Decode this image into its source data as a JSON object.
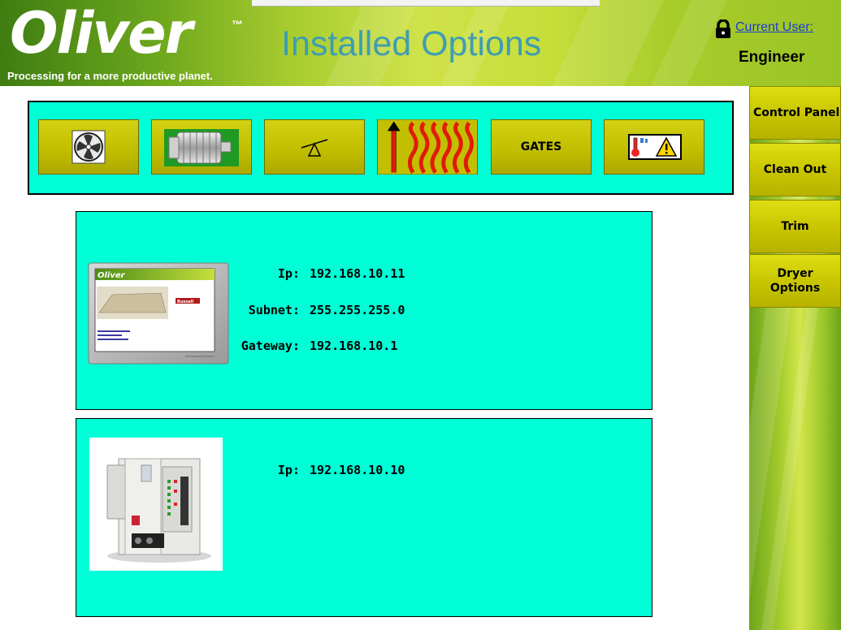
{
  "header": {
    "logo_text": "Oliver",
    "logo_tm": "™",
    "tagline": "Processing for a more productive planet.",
    "page_title": "Installed Options",
    "user_link": "Current User:",
    "user_name": "Engineer",
    "lock_icon": "lock-icon"
  },
  "toolbar": {
    "buttons": [
      {
        "name": "fan-icon",
        "label": ""
      },
      {
        "name": "motor-icon",
        "label": ""
      },
      {
        "name": "scale-icon",
        "label": ""
      },
      {
        "name": "heat-icon",
        "label": ""
      },
      {
        "name": "gates",
        "label": "GATES"
      },
      {
        "name": "temperature-warning-icon",
        "label": ""
      }
    ]
  },
  "side_menu": {
    "items": [
      {
        "label": "Control Panel"
      },
      {
        "label": "Clean Out"
      },
      {
        "label": "Trim"
      },
      {
        "label_line1": "Dryer",
        "label_line2": "Options"
      }
    ]
  },
  "devices": [
    {
      "image": "hmi-touchscreen-image",
      "fields": [
        {
          "label": "Ip:",
          "value": "192.168.10.11"
        },
        {
          "label": "Subnet:",
          "value": "255.255.255.0"
        },
        {
          "label": "Gateway:",
          "value": "192.168.10.1"
        }
      ]
    },
    {
      "image": "plc-controller-image",
      "fields": [
        {
          "label": "Ip:",
          "value": "192.168.10.10"
        }
      ]
    }
  ],
  "hmi_screen": {
    "logo": "Oliver",
    "badge": "Russell"
  },
  "colors": {
    "panel_bg": "#00ffd6",
    "button_olive": "#c2bf00",
    "title_teal": "#3f9db1",
    "link_blue": "#1c3cd4"
  }
}
